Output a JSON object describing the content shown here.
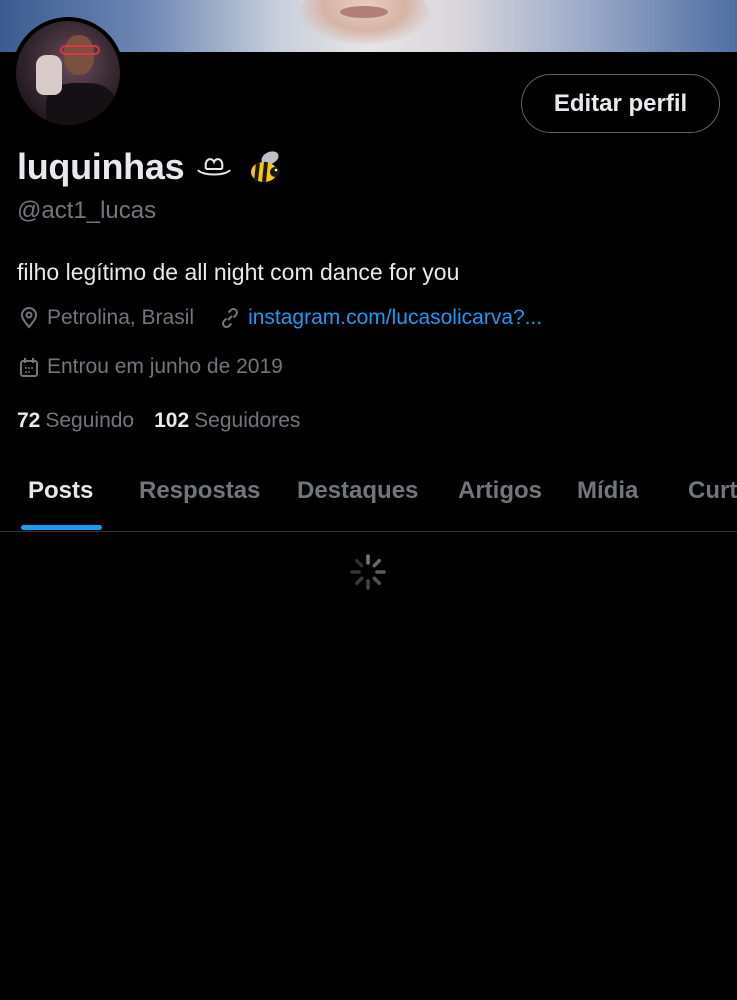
{
  "profile": {
    "display_name": "luquinhas",
    "name_emojis": [
      "hat-icon",
      "bee-icon"
    ],
    "handle": "@act1_lucas",
    "bio": "filho legítimo de all night com dance for you",
    "location": "Petrolina, Brasil",
    "website": "instagram.com/lucasolicarva?...",
    "joined": "Entrou em junho de 2019",
    "following_count": "72",
    "following_label": "Seguindo",
    "followers_count": "102",
    "followers_label": "Seguidores"
  },
  "actions": {
    "edit_profile_label": "Editar perfil"
  },
  "tabs": [
    {
      "label": "Posts",
      "active": true
    },
    {
      "label": "Respostas",
      "active": false
    },
    {
      "label": "Destaques",
      "active": false
    },
    {
      "label": "Artigos",
      "active": false
    },
    {
      "label": "Mídia",
      "active": false
    },
    {
      "label": "Curt",
      "active": false
    }
  ],
  "colors": {
    "background": "#000000",
    "text_primary": "#e7e9ea",
    "text_secondary": "#71767b",
    "accent": "#1d9bf0",
    "border": "#2f3336"
  },
  "status": {
    "feed_loading": true,
    "loading_icon": "spinner-icon"
  }
}
